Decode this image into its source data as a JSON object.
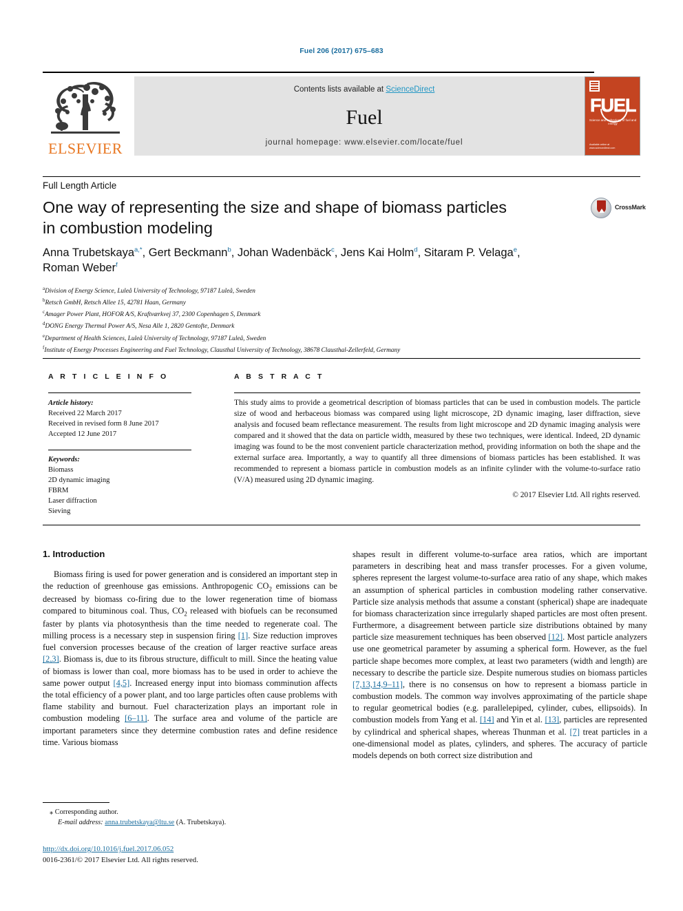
{
  "running_head": "Fuel 206 (2017) 675–683",
  "masthead": {
    "contents_prefix": "Contents lists available at ",
    "contents_link": "ScienceDirect",
    "journal_name": "Fuel",
    "homepage": "journal homepage: www.elsevier.com/locate/fuel",
    "publisher_wordmark": "ELSEVIER",
    "cover_title": "FUEL",
    "cover_subtitle": "Science and technology of fuel and energy",
    "cover_footer": "Available online at\nwww.sciencedirect.com"
  },
  "article": {
    "type": "Full Length Article",
    "title_line1": "One way of representing the size and shape of biomass particles",
    "title_line2": "in combustion modeling",
    "crossmark_label": "CrossMark"
  },
  "authors": {
    "list": [
      {
        "name": "Anna Trubetskaya",
        "marks": "a,*"
      },
      {
        "name": "Gert Beckmann",
        "marks": "b"
      },
      {
        "name": "Johan Wadenbäck",
        "marks": "c"
      },
      {
        "name": "Jens Kai Holm",
        "marks": "d"
      },
      {
        "name": "Sitaram P. Velaga",
        "marks": "e"
      },
      {
        "name": "Roman Weber",
        "marks": "f"
      }
    ]
  },
  "affiliations": [
    {
      "mark": "a",
      "text": "Division of Energy Science, Luleå University of Technology, 97187 Luleå, Sweden"
    },
    {
      "mark": "b",
      "text": "Retsch GmbH, Retsch Allee 15, 42781 Haan, Germany"
    },
    {
      "mark": "c",
      "text": "Amager Power Plant, HOFOR A/S, Kraftværkvej 37, 2300 Copenhagen S, Denmark"
    },
    {
      "mark": "d",
      "text": "DONG Energy Thermal Power A/S, Nesa Alle 1, 2820 Gentofte, Denmark"
    },
    {
      "mark": "e",
      "text": "Department of Health Sciences, Luleå University of Technology, 97187 Luleå, Sweden"
    },
    {
      "mark": "f",
      "text": "Institute of Energy Processes Engineering and Fuel Technology, Clausthal University of Technology, 38678 Clausthal-Zellerfeld, Germany"
    }
  ],
  "article_info": {
    "heading": "A R T I C L E    I N F O",
    "history_label": "Article history:",
    "history": [
      "Received 22 March 2017",
      "Received in revised form 8 June 2017",
      "Accepted 12 June 2017"
    ],
    "keywords_label": "Keywords:",
    "keywords": [
      "Biomass",
      "2D dynamic imaging",
      "FBRM",
      "Laser diffraction",
      "Sieving"
    ]
  },
  "abstract": {
    "heading": "A B S T R A C T",
    "text": "This study aims to provide a geometrical description of biomass particles that can be used in combustion models. The particle size of wood and herbaceous biomass was compared using light microscope, 2D dynamic imaging, laser diffraction, sieve analysis and focused beam reflectance measurement. The results from light microscope and 2D dynamic imaging analysis were compared and it showed that the data on particle width, measured by these two techniques, were identical. Indeed, 2D dynamic imaging was found to be the most convenient particle characterization method, providing information on both the shape and the external surface area. Importantly, a way to quantify all three dimensions of biomass particles has been established. It was recommended to represent a biomass particle in combustion models as an infinite cylinder with the volume-to-surface ratio (V/A) measured using 2D dynamic imaging.",
    "copyright": "© 2017 Elsevier Ltd. All rights reserved."
  },
  "body": {
    "section_title": "1. Introduction",
    "left_paragraph_parts": [
      "Biomass firing is used for power generation and is considered an important step in the reduction of greenhouse gas emissions. Anthropogenic CO",
      "2",
      " emissions can be decreased by biomass co-firing due to the lower regeneration time of biomass compared to bituminous coal. Thus, CO",
      "2",
      " released with biofuels can be reconsumed faster by plants via photosynthesis than the time needed to regenerate coal. The milling process is a necessary step in suspension firing ",
      "[1]",
      ". Size reduction improves fuel conversion processes because of the creation of larger reactive surface areas ",
      "[2,3]",
      ". Biomass is, due to its fibrous structure, difficult to mill. Since the heating value of biomass is lower than coal, more biomass has to be used in order to achieve the same power output ",
      "[4,5]",
      ". Increased energy input into biomass comminution affects the total efficiency of a power plant, and too large particles often cause problems with flame stability and burnout. Fuel characterization plays an important role in combustion modeling ",
      "[6–11]",
      ". The surface area and volume of the particle are important parameters since they determine combustion rates and define residence time. Various biomass"
    ],
    "right_paragraph_parts": [
      "shapes result in different volume-to-surface area ratios, which are important parameters in describing heat and mass transfer processes. For a given volume, spheres represent the largest volume-to-surface area ratio of any shape, which makes an assumption of spherical particles in combustion modeling rather conservative. Particle size analysis methods that assume a constant (spherical) shape are inadequate for biomass characterization since irregularly shaped particles are most often present. Furthermore, a disagreement between particle size distributions obtained by many particle size measurement techniques has been observed ",
      "[12]",
      ". Most particle analyzers use one geometrical parameter by assuming a spherical form. However, as the fuel particle shape becomes more complex, at least two parameters (width and length) are necessary to describe the particle size. Despite numerous studies on biomass particles ",
      "[7,13,14,9–11]",
      ", there is no consensus on how to represent a biomass particle in combustion models. The common way involves approximating of the particle shape to regular geometrical bodies (e.g. parallelepiped, cylinder, cubes, ellipsoids). In combustion models from Yang et al. ",
      "[14]",
      " and Yin et al. ",
      "[13]",
      ", particles are represented by cylindrical and spherical shapes, whereas Thunman et al. ",
      "[7]",
      " treat particles in a one-dimensional model as plates, cylinders, and spheres. The accuracy of particle models depends on both correct size distribution and"
    ]
  },
  "footnotes": {
    "corresponding": "Corresponding author.",
    "email_label": "E-mail address:",
    "email": "anna.trubetskaya@ltu.se",
    "email_owner": "(A. Trubetskaya).",
    "doi": "http://dx.doi.org/10.1016/j.fuel.2017.06.052",
    "issn_line": "0016-2361/© 2017 Elsevier Ltd. All rights reserved."
  },
  "colors": {
    "link_blue": "#1a6d9e",
    "sciencedirect_blue": "#2196c4",
    "elsevier_orange": "#e87722",
    "cover_orange": "#c44421",
    "crossmark_red": "#ab2317"
  }
}
